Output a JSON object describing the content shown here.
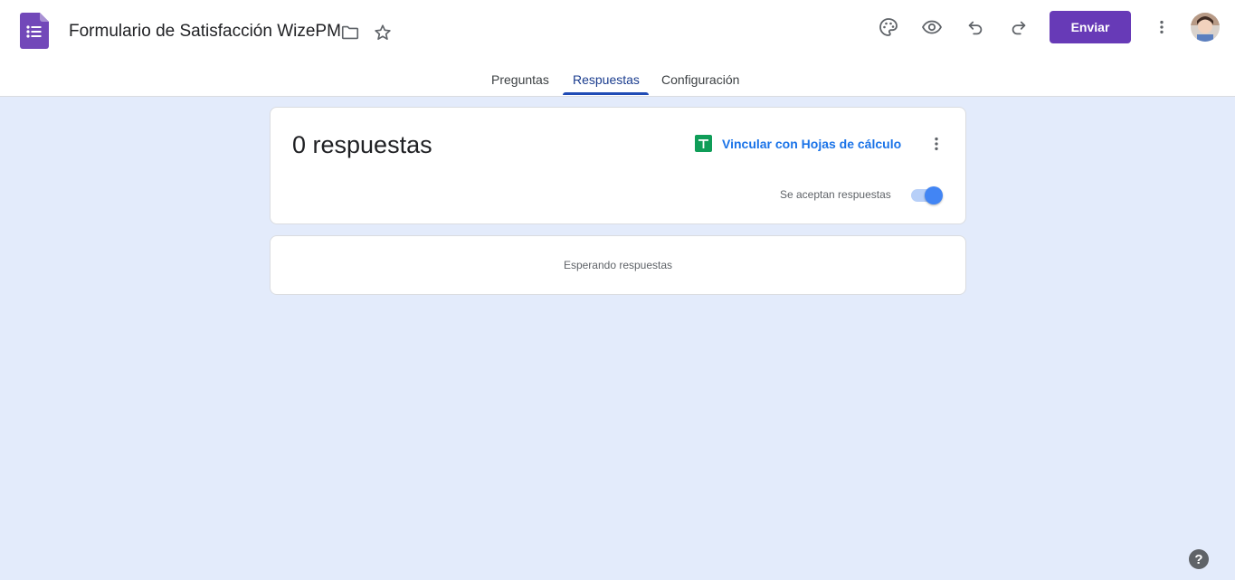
{
  "header": {
    "title": "Formulario de Satisfacción WizePM",
    "send_label": "Enviar",
    "icons": [
      "forms-logo-icon",
      "folder-icon",
      "star-icon",
      "palette-icon",
      "eye-icon",
      "undo-icon",
      "redo-icon",
      "more-vert-icon",
      "avatar"
    ]
  },
  "tabs": [
    {
      "label": "Preguntas",
      "active": false
    },
    {
      "label": "Respuestas",
      "active": true
    },
    {
      "label": "Configuración",
      "active": false
    }
  ],
  "summary": {
    "count_text": "0 respuestas",
    "link_label": "Vincular con Hojas de cálculo",
    "accepting_label": "Se aceptan respuestas",
    "accepting": true
  },
  "waiting": {
    "text": "Esperando respuestas"
  },
  "help": {
    "glyph": "?"
  },
  "colors": {
    "brand_purple": "#673ab7",
    "background": "#e3ebfb",
    "link_blue": "#1a73e8",
    "sheets_green": "#0f9d58",
    "toggle_blue": "#4285f4"
  }
}
